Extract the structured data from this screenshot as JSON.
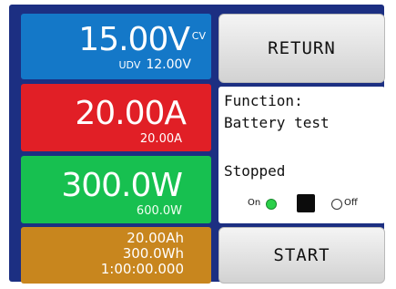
{
  "voltage": {
    "value": "15.00",
    "unit": "V",
    "mode": "CV",
    "sub_label": "UDV",
    "sub_value": "12.00V"
  },
  "current": {
    "value": "20.00A",
    "sub_value": "20.00A"
  },
  "power": {
    "value": "300.0W",
    "sub_value": "600.0W"
  },
  "energy": {
    "ah": "20.00Ah",
    "wh": "300.0Wh",
    "time": "1:00:00.000"
  },
  "buttons": {
    "return_label": "RETURN",
    "start_label": "START"
  },
  "info": {
    "function_label": "Function:",
    "function_value": "Battery test",
    "status": "Stopped",
    "switch_on_label": "On",
    "switch_off_label": "Off"
  },
  "colors": {
    "voltage": "#1478c8",
    "current": "#e11f26",
    "power": "#17c050",
    "energy": "#c8861e",
    "frame": "#1c2f82"
  }
}
